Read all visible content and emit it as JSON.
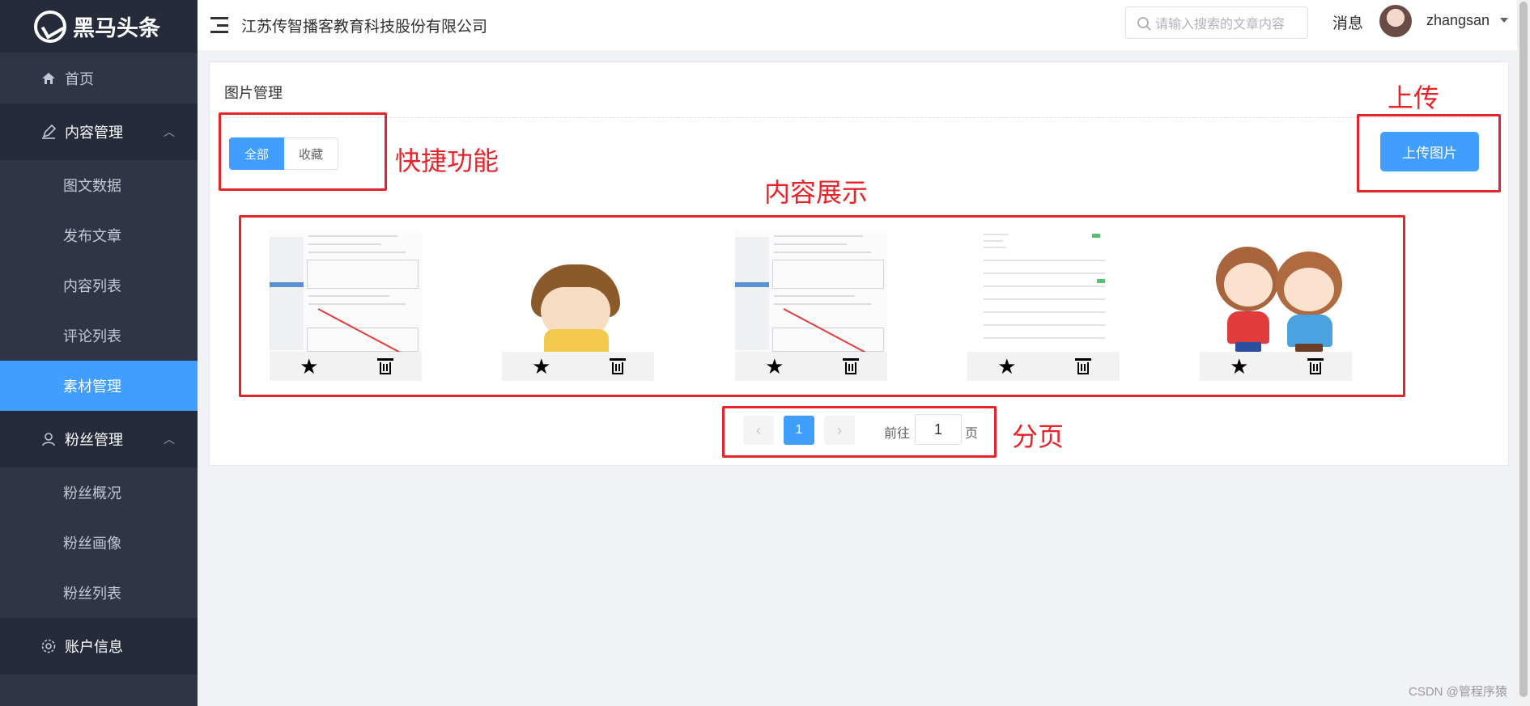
{
  "app": {
    "logo_text": "黑马头条"
  },
  "sidebar": {
    "items": [
      {
        "label": "首页",
        "icon": "home-icon"
      },
      {
        "label": "内容管理",
        "icon": "edit-icon"
      },
      {
        "label": "粉丝管理",
        "icon": "user-icon"
      },
      {
        "label": "账户信息",
        "icon": "gear-icon"
      }
    ],
    "content_sub": [
      "图文数据",
      "发布文章",
      "内容列表",
      "评论列表",
      "素材管理"
    ],
    "fans_sub": [
      "粉丝概况",
      "粉丝画像",
      "粉丝列表"
    ],
    "active": "素材管理"
  },
  "header": {
    "company": "江苏传智播客教育科技股份有限公司",
    "search_placeholder": "请输入搜索的文章内容",
    "messages": "消息",
    "username": "zhangsan"
  },
  "main": {
    "title": "图片管理",
    "tabs": [
      "全部",
      "收藏"
    ],
    "active_tab": "全部",
    "upload_button": "上传图片",
    "images": [
      {
        "kind": "screenshot"
      },
      {
        "kind": "cartoon-boy"
      },
      {
        "kind": "screenshot"
      },
      {
        "kind": "table-screenshot"
      },
      {
        "kind": "cartoon-girls"
      }
    ],
    "pagination": {
      "current_page": "1",
      "goto_label": "前往",
      "goto_value": "1",
      "page_unit": "页"
    }
  },
  "annotations": {
    "quick": "快捷功能",
    "upload": "上传",
    "content": "内容展示",
    "paging": "分页"
  },
  "watermark": "CSDN @管程序猿",
  "colors": {
    "primary": "#409eff",
    "sidebar": "#2f3447",
    "annotation": "#e8242b"
  }
}
